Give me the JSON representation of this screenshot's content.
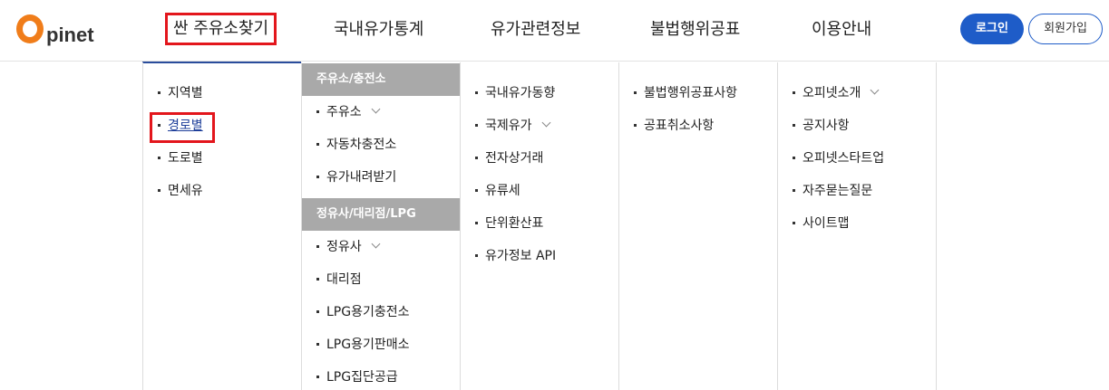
{
  "brand": {
    "logo_text": "pinet",
    "accent": "#f07d1a"
  },
  "gnb": [
    {
      "label": "싼 주유소찾기",
      "active": true
    },
    {
      "label": "국내유가통계",
      "active": false
    },
    {
      "label": "유가관련정보",
      "active": false
    },
    {
      "label": "불법행위공표",
      "active": false
    },
    {
      "label": "이용안내",
      "active": false
    }
  ],
  "auth": {
    "login_label": "로그인",
    "join_label": "회원가입",
    "primary_color": "#1e5cc8"
  },
  "menu": {
    "col1": [
      {
        "label": "지역별"
      },
      {
        "label": "경로별",
        "current": true
      },
      {
        "label": "도로별"
      },
      {
        "label": "면세유"
      }
    ],
    "col2": {
      "section1": "주유소/충전소",
      "items1": [
        {
          "label": "주유소",
          "expandable": true
        },
        {
          "label": "자동차충전소"
        },
        {
          "label": "유가내려받기"
        }
      ],
      "section2": "정유사/대리점/LPG",
      "items2": [
        {
          "label": "정유사",
          "expandable": true
        },
        {
          "label": "대리점"
        },
        {
          "label": "LPG용기충전소"
        },
        {
          "label": "LPG용기판매소"
        },
        {
          "label": "LPG집단공급"
        }
      ]
    },
    "col3": [
      {
        "label": "국내유가동향"
      },
      {
        "label": "국제유가",
        "expandable": true
      },
      {
        "label": "전자상거래"
      },
      {
        "label": "유류세"
      },
      {
        "label": "단위환산표"
      },
      {
        "label": "유가정보 API"
      }
    ],
    "col4": [
      {
        "label": "불법행위공표사항"
      },
      {
        "label": "공표취소사항"
      }
    ],
    "col5": [
      {
        "label": "오피넷소개",
        "expandable": true
      },
      {
        "label": "공지사항"
      },
      {
        "label": "오피넷스타트업"
      },
      {
        "label": "자주묻는질문"
      },
      {
        "label": "사이트맵"
      }
    ]
  }
}
